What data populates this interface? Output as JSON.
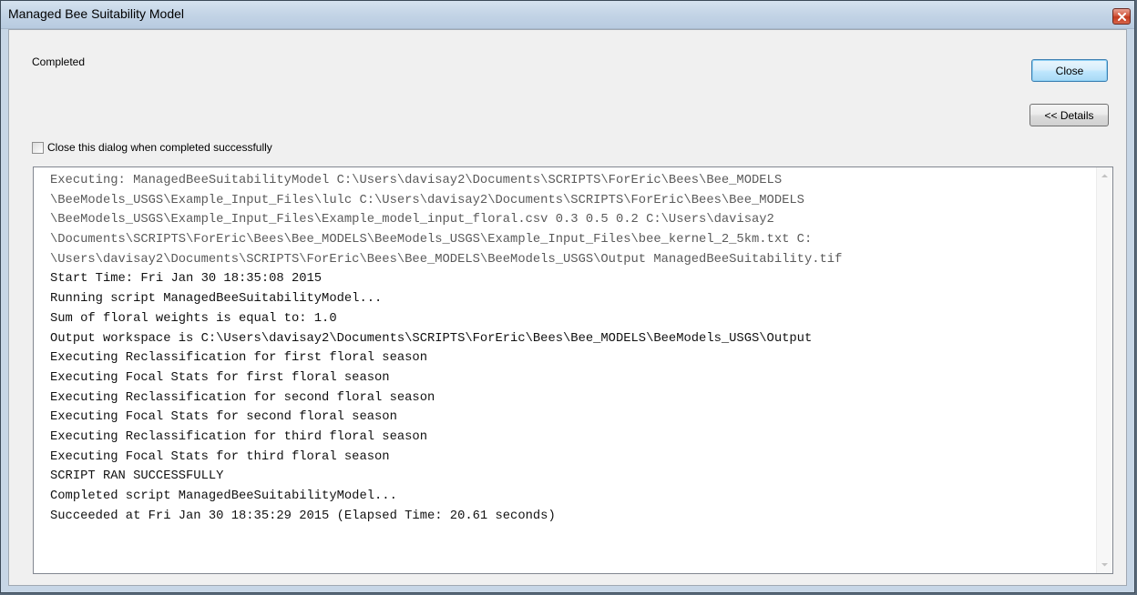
{
  "window": {
    "title": "Managed Bee Suitability Model"
  },
  "status": {
    "text": "Completed"
  },
  "buttons": {
    "close_label": "Close",
    "details_label": "<< Details"
  },
  "checkbox": {
    "label": "Close this dialog when completed successfully",
    "checked": false
  },
  "log": {
    "lines": [
      "Executing: ManagedBeeSuitabilityModel C:\\Users\\davisay2\\Documents\\SCRIPTS\\ForEric\\Bees\\Bee_MODELS",
      "\\BeeModels_USGS\\Example_Input_Files\\lulc C:\\Users\\davisay2\\Documents\\SCRIPTS\\ForEric\\Bees\\Bee_MODELS",
      "\\BeeModels_USGS\\Example_Input_Files\\Example_model_input_floral.csv 0.3 0.5 0.2 C:\\Users\\davisay2",
      "\\Documents\\SCRIPTS\\ForEric\\Bees\\Bee_MODELS\\BeeModels_USGS\\Example_Input_Files\\bee_kernel_2_5km.txt C:",
      "\\Users\\davisay2\\Documents\\SCRIPTS\\ForEric\\Bees\\Bee_MODELS\\BeeModels_USGS\\Output ManagedBeeSuitability.tif",
      "Start Time: Fri Jan 30 18:35:08 2015",
      "Running script ManagedBeeSuitabilityModel...",
      "Sum of floral weights is equal to: 1.0",
      "Output workspace is C:\\Users\\davisay2\\Documents\\SCRIPTS\\ForEric\\Bees\\Bee_MODELS\\BeeModels_USGS\\Output",
      "Executing Reclassification for first floral season",
      "Executing Focal Stats for first floral season",
      "Executing Reclassification for second floral season",
      "Executing Focal Stats for second floral season",
      "Executing Reclassification for third floral season",
      "Executing Focal Stats for third floral season",
      "SCRIPT RAN SUCCESSFULLY",
      "Completed script ManagedBeeSuitabilityModel...",
      "Succeeded at Fri Jan 30 18:35:29 2015 (Elapsed Time: 20.61 seconds)"
    ]
  },
  "colors": {
    "title_bar": "#c3d4e6",
    "close_x": "#c23a1f",
    "default_button": "#bee6fd",
    "log_text": "#111111",
    "log_text_gray": "#5a5a5a"
  },
  "icons": {
    "window_close": "close-icon",
    "scroll_up": "scroll-up-arrow-icon",
    "scroll_down": "scroll-down-arrow-icon"
  }
}
